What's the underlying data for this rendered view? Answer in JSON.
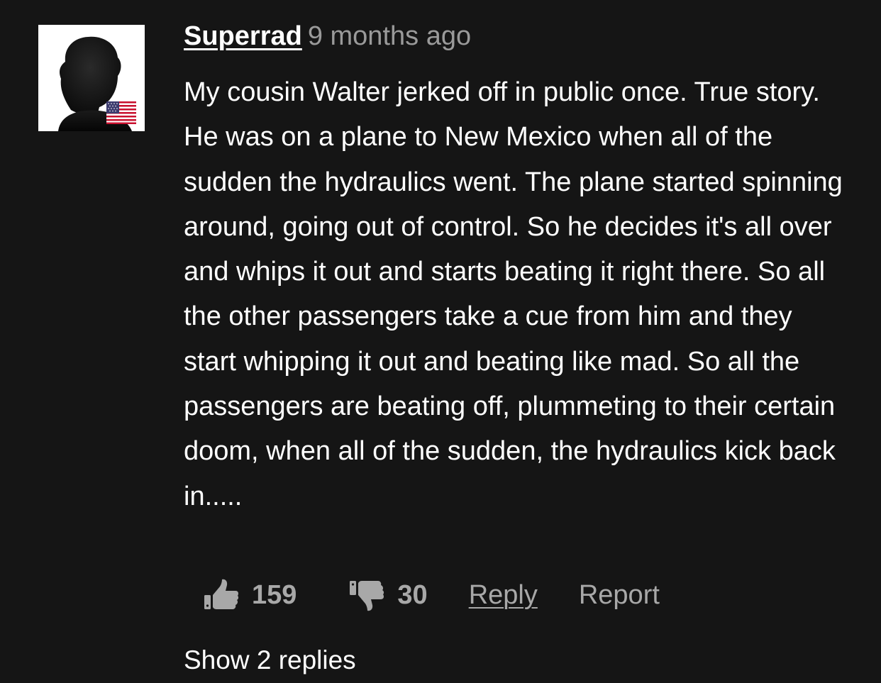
{
  "comment": {
    "username": "Superrad",
    "timestamp": "9 months ago",
    "flag_icon": "us-flag-icon",
    "avatar_icon": "default-avatar-silhouette-icon",
    "body": "My cousin Walter jerked off in public once. True story. He was on a plane to New Mexico when all of the sudden the hydraulics went. The plane started spinning around, going out of control. So he decides it's all over and whips it out and starts beating it right there. So all the other passengers take a cue from him and they start whipping it out and beating like mad. So all the passengers are beating off, plummeting to their certain doom, when all of the sudden, the hydraulics kick back in.....",
    "actions": {
      "upvote_icon": "thumbs-up-icon",
      "upvote_count": "159",
      "downvote_icon": "thumbs-down-icon",
      "downvote_count": "30",
      "reply_label": "Reply",
      "report_label": "Report"
    },
    "show_replies_label": "Show 2 replies"
  },
  "colors": {
    "background": "#151515",
    "text_primary": "#ffffff",
    "text_muted": "#9a9a9a",
    "action_gray": "#a8a8a8"
  }
}
